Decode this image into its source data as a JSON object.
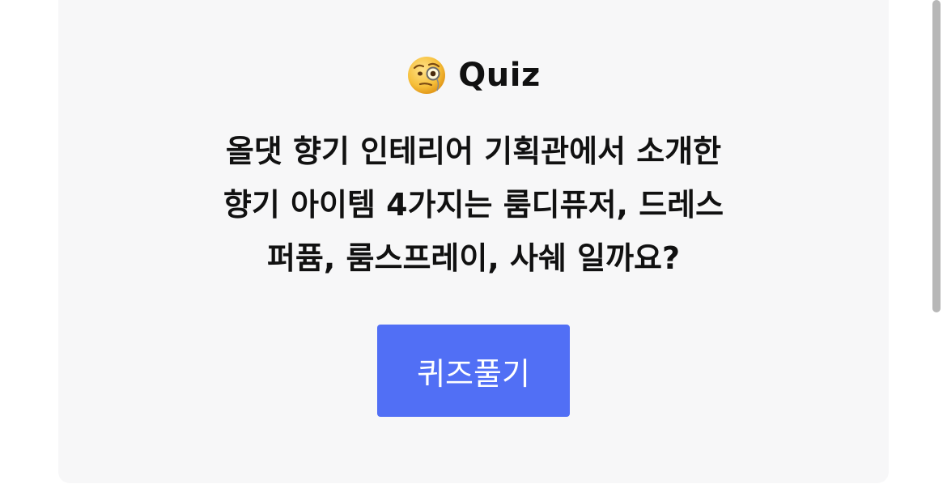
{
  "quiz": {
    "title": "Quiz",
    "emoji_icon": "face-with-monocle-icon",
    "question_lines": [
      "올댓 향기 인테리어 기획관에서 소개한",
      "향기 아이템 4가지는 룸디퓨저, 드레스",
      "퍼퓸, 룸스프레이, 사쉐 일까요?"
    ],
    "button_label": "퀴즈풀기"
  },
  "colors": {
    "card_background": "#f7f7f8",
    "button_background": "#516ff5",
    "button_text": "#ffffff",
    "text": "#111111",
    "scrollbar": "#b7b7b7"
  }
}
